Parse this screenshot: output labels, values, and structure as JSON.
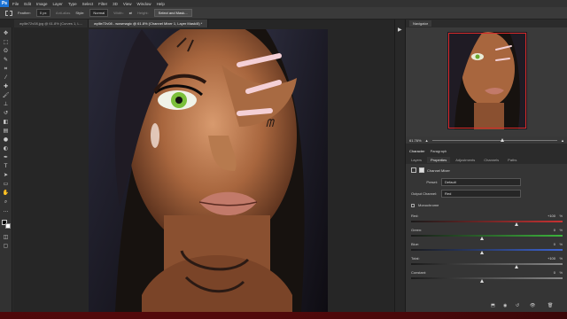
{
  "menu": {
    "logo": "Ps",
    "items": [
      "File",
      "Edit",
      "Image",
      "Layer",
      "Type",
      "Select",
      "Filter",
      "3D",
      "View",
      "Window",
      "Help"
    ]
  },
  "options": {
    "feather_label": "Feather:",
    "feather_value": "0 px",
    "antialias_label": "Anti-alias",
    "style_label": "Style:",
    "style_value": "Normal",
    "width_label": "Width:",
    "height_label": "Height:",
    "select_mask_button": "Select and Mask..."
  },
  "tabs": [
    {
      "label": "wyllie72v08.jpg @ 61.8% (Curves 1, L...",
      "active": false
    },
    {
      "label": "wyllie72v08 - wowmagic @ 61.8% (Channel Mixer 1, Layer Mask/8) *",
      "active": true
    }
  ],
  "navigator": {
    "tab_label": "Navigator",
    "zoom_value": "61.76%",
    "zoom_fraction": 0.55
  },
  "character_tabs": [
    "Character",
    "Paragraph"
  ],
  "properties": {
    "tabs": [
      {
        "label": "Layers",
        "active": false
      },
      {
        "label": "Properties",
        "active": true
      },
      {
        "label": "Adjustments",
        "active": false
      },
      {
        "label": "Channels",
        "active": false
      },
      {
        "label": "Paths",
        "active": false
      }
    ],
    "title": "Channel Mixer",
    "preset_label": "Preset:",
    "preset_value": "Default",
    "output_label": "Output Channel:",
    "output_value": "Red",
    "monochrome_label": "Monochrome",
    "sliders": [
      {
        "name": "Red:",
        "value": "+100",
        "pct": "%",
        "fraction": 0.75,
        "color": "#c83232"
      },
      {
        "name": "Green:",
        "value": "0",
        "pct": "%",
        "fraction": 0.5,
        "color": "#3cb43c"
      },
      {
        "name": "Blue:",
        "value": "0",
        "pct": "%",
        "fraction": 0.5,
        "color": "#3c64d2"
      },
      {
        "name": "Total:",
        "value": "+100",
        "pct": "%",
        "fraction": 0.75,
        "color": "#888888"
      },
      {
        "name": "Constant:",
        "value": "0",
        "pct": "%",
        "fraction": 0.5,
        "color": "#888888"
      }
    ]
  },
  "colors": {
    "accent": "#1c73d4",
    "foreground": "#000000",
    "background": "#ffffff"
  }
}
